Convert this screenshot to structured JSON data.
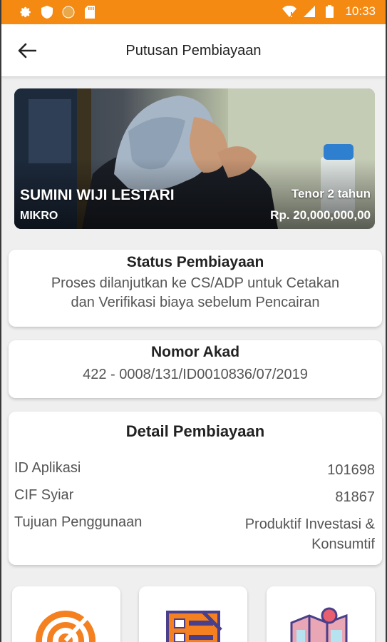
{
  "status_bar": {
    "time": "10:33",
    "icons": [
      "gear-icon",
      "shield-icon",
      "circle-icon",
      "sd-card-icon",
      "wifi-icon",
      "signal-icon",
      "battery-icon"
    ]
  },
  "app_bar": {
    "title": "Putusan Pembiayaan",
    "back_icon": "arrow-left-icon"
  },
  "hero": {
    "name": "SUMINI WIJI LESTARI",
    "type": "MIKRO",
    "tenor": "Tenor 2 tahun",
    "amount": "Rp. 20,000,000,00"
  },
  "status_card": {
    "title": "Status Pembiayaan",
    "line1": "Proses dilanjutkan ke CS/ADP untuk Cetakan",
    "line2": "dan Verifikasi biaya sebelum Pencairan"
  },
  "akad_card": {
    "title": "Nomor Akad",
    "value": "422 - 0008/131/ID0010836/07/2019"
  },
  "detail_card": {
    "title": "Detail Pembiayaan",
    "rows": [
      {
        "label": "ID Aplikasi",
        "value": "101698"
      },
      {
        "label": "CIF Syiar",
        "value": "81867"
      },
      {
        "label": "Tujuan Penggunaan",
        "value_line1": "Produktif Investasi &",
        "value_line2": "Konsumtif"
      }
    ]
  },
  "menu_tiles": [
    "target-icon",
    "checklist-icon",
    "map-icon"
  ],
  "colors": {
    "status_bar": "#f58a12",
    "accent_orange": "#f4801f",
    "card_bg": "#ffffff",
    "page_bg": "#efefef"
  }
}
